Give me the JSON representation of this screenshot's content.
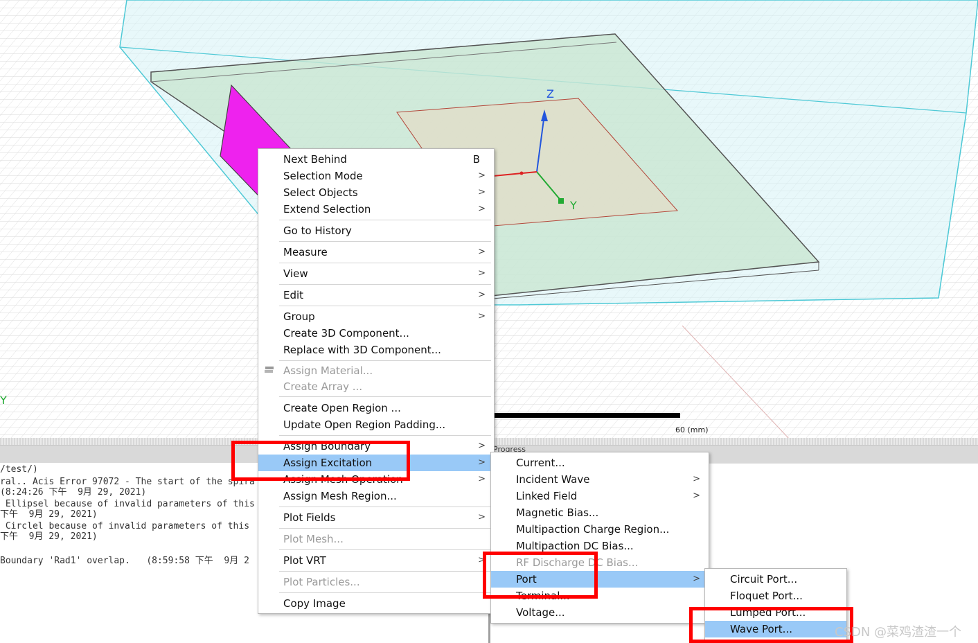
{
  "viewport": {
    "axis": {
      "z_label": "Z",
      "y_label": "Y",
      "corner_y_label": "Y"
    },
    "scale": {
      "label": "60 (mm)"
    }
  },
  "progress_label": "Progress",
  "message_pane": {
    "lines": [
      "/test/)",
      "ral.. Acis Error 97072 - The start of the spira",
      "(8:24:26 下午  9月 29, 2021)",
      " Ellipsel because of invalid parameters of this",
      "下午  9月 29, 2021)",
      " Circlel because of invalid parameters of this",
      "下午  9月 29, 2021)",
      "",
      "Boundary 'Rad1' overlap.   (8:59:58 下午  9月 2"
    ]
  },
  "context_menu": {
    "items": [
      {
        "label": "Next Behind",
        "shortcut": "B"
      },
      {
        "label": "Selection Mode",
        "arrow": ">"
      },
      {
        "label": "Select Objects",
        "arrow": ">"
      },
      {
        "label": "Extend Selection",
        "arrow": ">"
      },
      {
        "label": "Go to History"
      },
      {
        "label": "Measure",
        "arrow": ">"
      },
      {
        "label": "View",
        "arrow": ">"
      },
      {
        "label": "Edit",
        "arrow": ">"
      },
      {
        "label": "Group",
        "arrow": ">"
      },
      {
        "label": "Create 3D Component..."
      },
      {
        "label": "Replace with 3D Component..."
      },
      {
        "label": "Assign Material..."
      },
      {
        "label": "Create Array ..."
      },
      {
        "label": "Create Open Region ..."
      },
      {
        "label": "Update Open Region Padding..."
      },
      {
        "label": "Assign Boundary",
        "arrow": ">"
      },
      {
        "label": "Assign Excitation",
        "arrow": ">"
      },
      {
        "label": "Assign Mesh Operation",
        "arrow": ">"
      },
      {
        "label": "Assign Mesh Region..."
      },
      {
        "label": "Plot Fields",
        "arrow": ">"
      },
      {
        "label": "Plot Mesh..."
      },
      {
        "label": "Plot VRT",
        "arrow": ">"
      },
      {
        "label": "Plot Particles..."
      },
      {
        "label": "Copy Image"
      }
    ]
  },
  "excitation_menu": {
    "items": [
      {
        "label": "Current..."
      },
      {
        "label": "Incident Wave",
        "arrow": ">"
      },
      {
        "label": "Linked Field",
        "arrow": ">"
      },
      {
        "label": "Magnetic Bias..."
      },
      {
        "label": "Multipaction Charge Region..."
      },
      {
        "label": "Multipaction DC Bias..."
      },
      {
        "label": "RF Discharge DC Bias..."
      },
      {
        "label": "Port",
        "arrow": ">"
      },
      {
        "label": "Terminal..."
      },
      {
        "label": "Voltage..."
      }
    ]
  },
  "port_menu": {
    "items": [
      {
        "label": "Circuit Port..."
      },
      {
        "label": "Floquet Port..."
      },
      {
        "label": "Lumped Port..."
      },
      {
        "label": "Wave Port..."
      }
    ]
  },
  "watermark": "CSDN @菜鸡渣渣一个",
  "colors": {
    "highlight": "#99c9f7",
    "annotation_red": "#ff0000",
    "port_face": "#ee22ee",
    "region_edge": "#3fc9d6",
    "substrate_fill": "#c9e6d2"
  }
}
